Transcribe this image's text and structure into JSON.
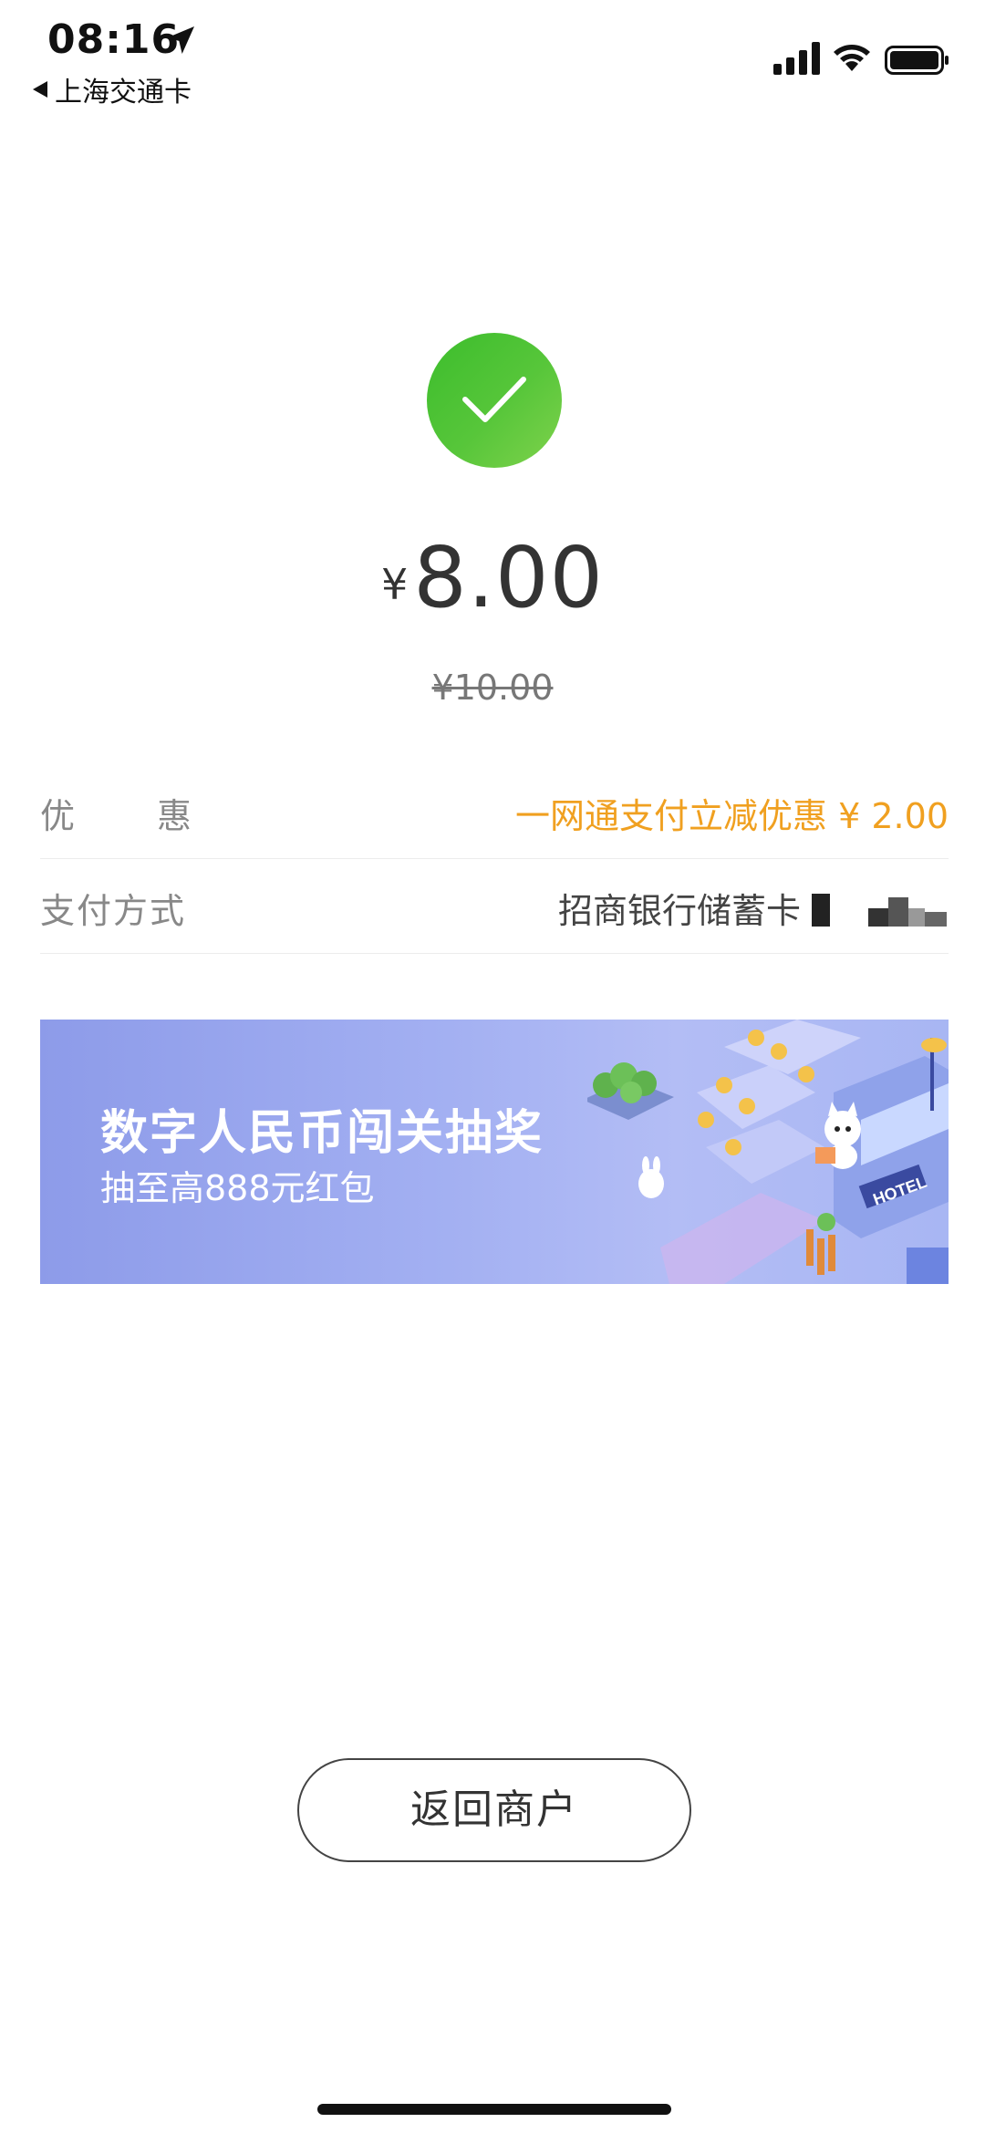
{
  "status_bar": {
    "time": "08:16",
    "back_app": "上海交通卡",
    "icons": [
      "location-arrow-icon",
      "signal-icon",
      "wifi-icon",
      "battery-icon"
    ]
  },
  "payment": {
    "status_icon": "check-icon",
    "currency": "¥",
    "amount": "8.00",
    "original_price": "¥10.00",
    "discount_label": "优惠",
    "discount_value": "一网通支付立减优惠 ¥ 2.00",
    "method_label": "支付方式",
    "method_value": "招商银行储蓄卡"
  },
  "banner": {
    "title": "数字人民币闯关抽奖",
    "subtitle": "抽至高888元红包",
    "hotel_sign": "HOTEL"
  },
  "actions": {
    "return_label": "返回商户"
  },
  "colors": {
    "success_green": "#4cc133",
    "discount_orange": "#f0a020",
    "banner_blue": "#a3b0f2"
  }
}
